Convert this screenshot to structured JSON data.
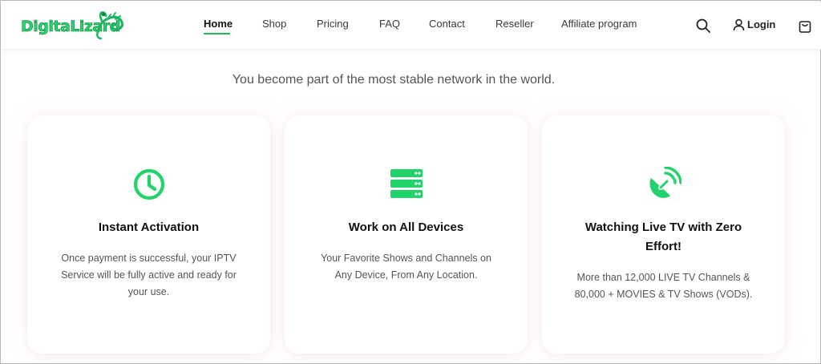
{
  "brand": {
    "name": "DigitaLizard",
    "accent": "#22d36b"
  },
  "nav": {
    "items": [
      {
        "label": "Home",
        "active": true
      },
      {
        "label": "Shop"
      },
      {
        "label": "Pricing"
      },
      {
        "label": "FAQ"
      },
      {
        "label": "Contact"
      },
      {
        "label": "Reseller"
      },
      {
        "label": "Affiliate program"
      }
    ],
    "login_label": "Login",
    "icons": [
      "search-icon",
      "user-icon",
      "cart-icon"
    ]
  },
  "tagline": "You become part of the most stable network in the world.",
  "features": [
    {
      "icon": "clock-icon",
      "title": "Instant Activation",
      "description": "Once payment is successful, your IPTV Service will be fully active and ready for your use."
    },
    {
      "icon": "server-icon",
      "title": "Work on All Devices",
      "description": "Your Favorite Shows and Channels on Any Device, From Any Location."
    },
    {
      "icon": "satellite-dish-icon",
      "title": "Watching Live TV with Zero Effort!",
      "description": "More than 12,000 LIVE TV Channels & 80,000 + MOVIES & TV Shows (VODs)."
    }
  ]
}
